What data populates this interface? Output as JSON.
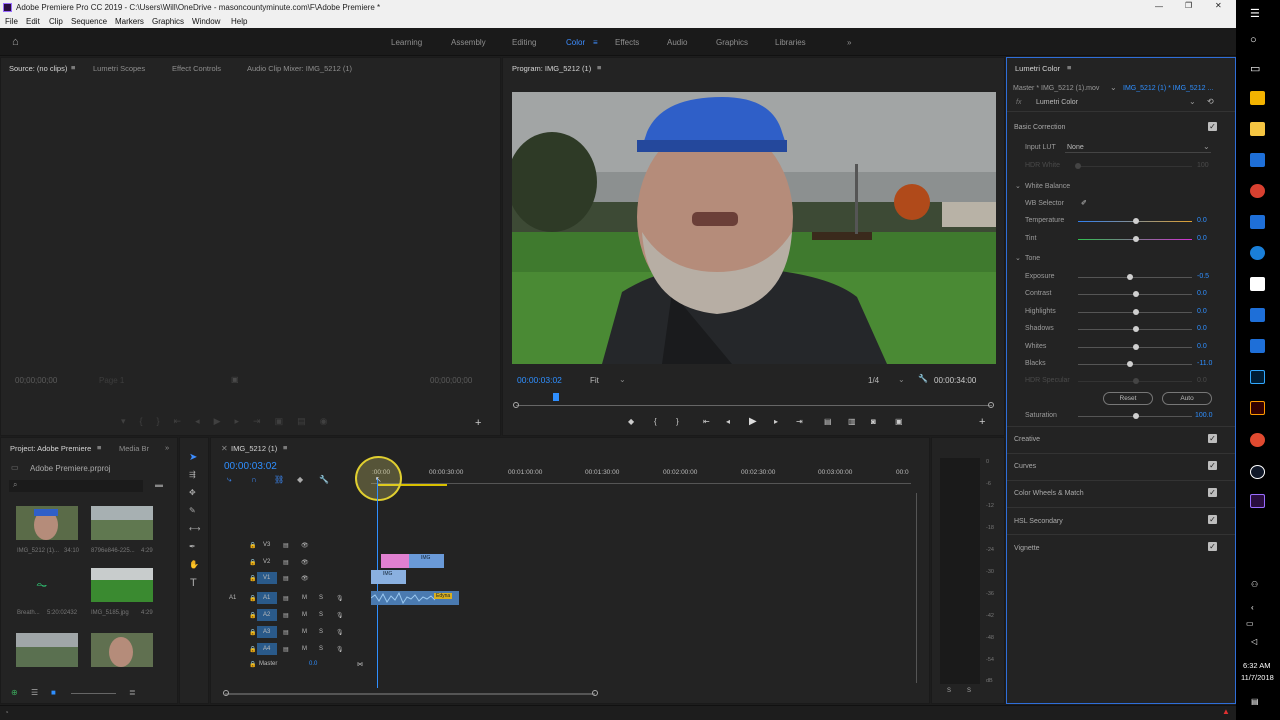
{
  "window": {
    "title": "Adobe Premiere Pro CC 2019 - C:\\Users\\Will\\OneDrive - masoncountyminute.com\\F\\Adobe Premiere *"
  },
  "menu": [
    "File",
    "Edit",
    "Clip",
    "Sequence",
    "Markers",
    "Graphics",
    "Window",
    "Help"
  ],
  "workspaces": [
    "Learning",
    "Assembly",
    "Editing",
    "Color",
    "Effects",
    "Audio",
    "Graphics",
    "Libraries"
  ],
  "workspace_active": "Color",
  "source_panel": {
    "tabs": [
      "Source: (no clips)",
      "Lumetri Scopes",
      "Effect Controls",
      "Audio Clip Mixer: IMG_5212 (1)"
    ],
    "tc_left": "00;00;00;00",
    "tc_right": "00;00;00;00",
    "page": "Page 1"
  },
  "program_panel": {
    "tab": "Program: IMG_5212 (1)",
    "timecode": "00:00:03:02",
    "fit": "Fit",
    "quality": "1/4",
    "duration": "00:00:34:00"
  },
  "project_panel": {
    "tabs": [
      "Project: Adobe Premiere",
      "Media Br"
    ],
    "file": "Adobe Premiere.prproj",
    "items": [
      {
        "name": "IMG_5212 (1)...",
        "duration": "34:10"
      },
      {
        "name": "8796e846-225...",
        "duration": "4:29"
      },
      {
        "name": "Breath...",
        "duration": "5:20:02432"
      },
      {
        "name": "IMG_5185.jpg",
        "duration": "4:29"
      },
      {
        "name": "",
        "duration": ""
      },
      {
        "name": "",
        "duration": ""
      }
    ]
  },
  "timeline": {
    "tab": "IMG_5212 (1)",
    "timecode": "00:00:03:02",
    "ruler": [
      ":00:00",
      "00:00:30:00",
      "00:01:00:00",
      "00:01:30:00",
      "00:02:00:00",
      "00:02:30:00",
      "00:03:00:00",
      "00:0"
    ],
    "video_tracks": [
      "V3",
      "V2",
      "V1"
    ],
    "audio_tracks": [
      "A1",
      "A2",
      "A3",
      "A4"
    ],
    "source_patch": "A1",
    "master_label": "Master",
    "master_value": "0.0",
    "clips": {
      "v2": "IMG",
      "v1": "IMG",
      "a1": "Edyna"
    }
  },
  "meter": {
    "scale": [
      "0",
      "-6",
      "-12",
      "-18",
      "-24",
      "-30",
      "-36",
      "-42",
      "-48",
      "-54",
      "dB"
    ],
    "solo": [
      "S",
      "S"
    ]
  },
  "lumetri": {
    "panel_title": "Lumetri Color",
    "master": "Master * IMG_5212 (1).mov",
    "clip": "IMG_5212 (1) * IMG_5212 ...",
    "fx_label": "fx",
    "fx": "Lumetri Color",
    "sections": {
      "basic": "Basic Correction",
      "input_lut_label": "Input LUT",
      "input_lut_value": "None",
      "hdr_white": "HDR White",
      "hdr_white_value": "100",
      "white_balance": "White Balance",
      "wb_selector": "WB Selector",
      "tone": "Tone",
      "hdr_specular": "HDR Specular",
      "hdr_specular_value": "0.0",
      "reset": "Reset",
      "auto": "Auto",
      "saturation": "Saturation",
      "saturation_value": "100.0"
    },
    "sliders": [
      {
        "label": "Temperature",
        "value": "0.0"
      },
      {
        "label": "Tint",
        "value": "0.0"
      },
      {
        "label": "Exposure",
        "value": "-0.5"
      },
      {
        "label": "Contrast",
        "value": "0.0"
      },
      {
        "label": "Highlights",
        "value": "0.0"
      },
      {
        "label": "Shadows",
        "value": "0.0"
      },
      {
        "label": "Whites",
        "value": "0.0"
      },
      {
        "label": "Blacks",
        "value": "-11.0"
      }
    ],
    "collapsed": [
      "Creative",
      "Curves",
      "Color Wheels & Match",
      "HSL Secondary",
      "Vignette"
    ]
  },
  "taskbar": {
    "time": "6:32 AM",
    "date": "11/7/2018"
  }
}
